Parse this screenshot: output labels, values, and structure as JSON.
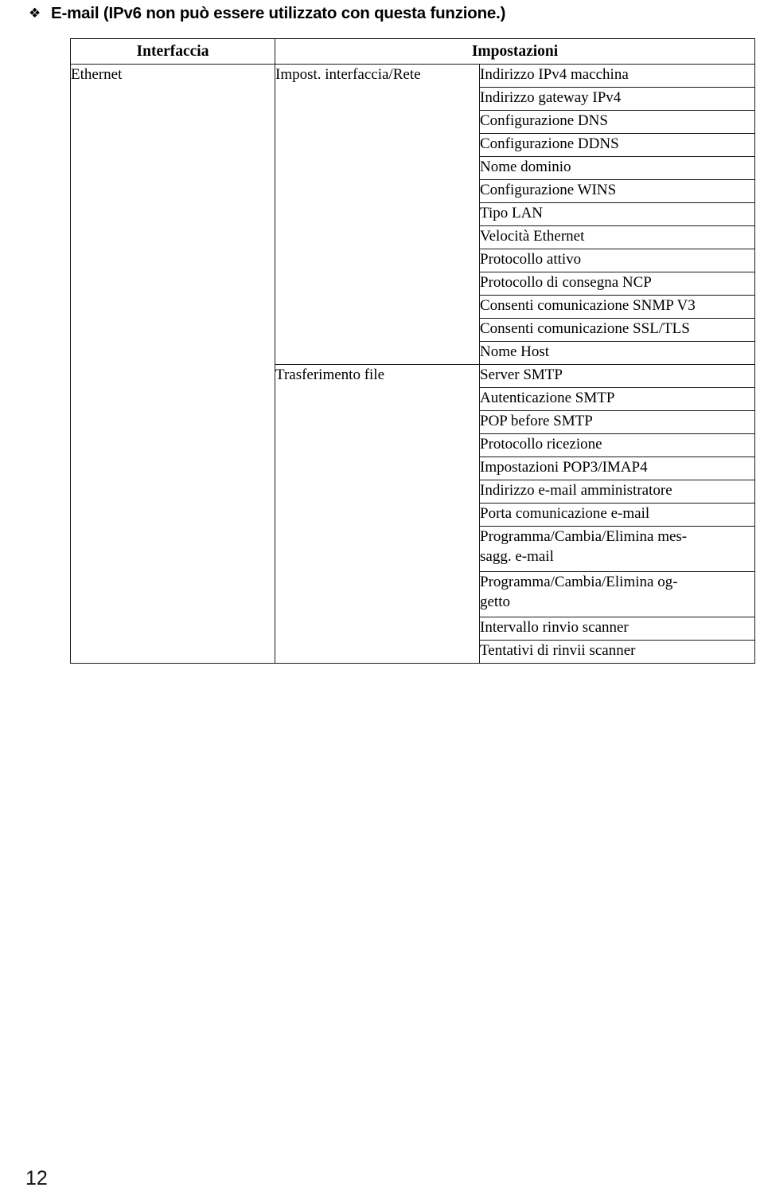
{
  "heading": {
    "bullet_icon": "diamond-bullet-icon",
    "bullet_glyph": "❖",
    "text": "E-mail (IPv6 non può essere utilizzato con questa funzione.)"
  },
  "table": {
    "headers": {
      "interface": "Interfaccia",
      "settings": "Impostazioni"
    },
    "interface_label": "Ethernet",
    "groups": [
      {
        "group_label": "Impost. interfaccia/Rete",
        "settings": [
          {
            "lines": [
              "Indirizzo IPv4 macchina"
            ]
          },
          {
            "lines": [
              "Indirizzo gateway IPv4"
            ]
          },
          {
            "lines": [
              "Configurazione DNS"
            ]
          },
          {
            "lines": [
              "Configurazione DDNS"
            ]
          },
          {
            "lines": [
              "Nome dominio"
            ]
          },
          {
            "lines": [
              "Configurazione WINS"
            ]
          },
          {
            "lines": [
              "Tipo LAN"
            ]
          },
          {
            "lines": [
              "Velocità Ethernet"
            ]
          },
          {
            "lines": [
              "Protocollo attivo"
            ]
          },
          {
            "lines": [
              "Protocollo di consegna NCP"
            ]
          },
          {
            "lines": [
              "Consenti comunicazione SNMP V3"
            ]
          },
          {
            "lines": [
              "Consenti comunicazione SSL/TLS"
            ]
          },
          {
            "lines": [
              "Nome Host"
            ]
          }
        ]
      },
      {
        "group_label": "Trasferimento file",
        "settings": [
          {
            "lines": [
              "Server SMTP"
            ]
          },
          {
            "lines": [
              "Autenticazione SMTP"
            ]
          },
          {
            "lines": [
              "POP before SMTP"
            ]
          },
          {
            "lines": [
              "Protocollo ricezione"
            ]
          },
          {
            "lines": [
              "Impostazioni POP3/IMAP4"
            ]
          },
          {
            "lines": [
              "Indirizzo e-mail amministratore"
            ]
          },
          {
            "lines": [
              "Porta comunicazione e-mail"
            ]
          },
          {
            "lines": [
              "Programma/Cambia/Elimina mes-",
              "sagg. e-mail"
            ]
          },
          {
            "lines": [
              "Programma/Cambia/Elimina og-",
              "getto"
            ]
          },
          {
            "lines": [
              "Intervallo rinvio scanner"
            ]
          },
          {
            "lines": [
              "Tentativi di rinvii scanner"
            ]
          }
        ]
      }
    ]
  },
  "footer": {
    "page_number": "12"
  }
}
